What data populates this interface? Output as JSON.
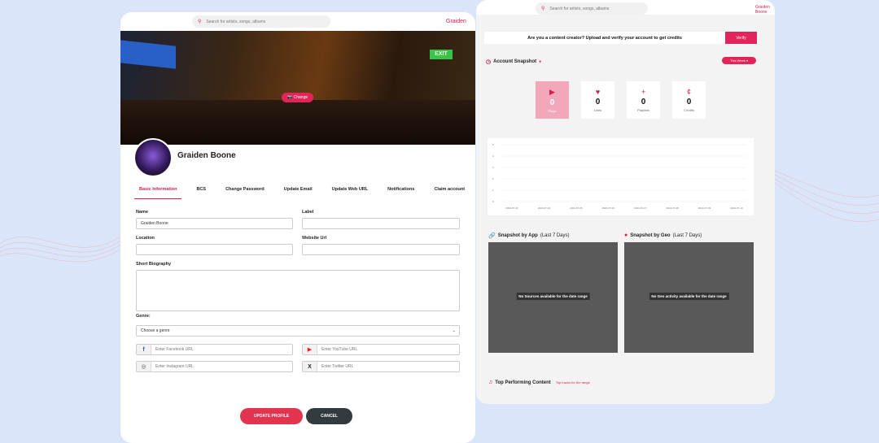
{
  "search": {
    "placeholder": "Search for artists, songs, albums",
    "icon": "search-icon"
  },
  "user_link": "Graiden Boone",
  "user_link_short": "Graiden",
  "profile": {
    "change_label": "Change",
    "name": "Graiden Boone",
    "tabs": [
      "Basic Information",
      "BCS",
      "Change Password",
      "Update Email",
      "Update Web URL",
      "Notifications",
      "Claim account"
    ],
    "active_tab": "Basic Information",
    "form": {
      "name_label": "Name",
      "name_value": "Graiden Boone",
      "label_label": "Label",
      "label_value": "",
      "location_label": "Location",
      "location_value": "",
      "website_label": "Website Url",
      "website_value": "",
      "bio_label": "Short Biography",
      "bio_value": "",
      "genre_label": "Genre:",
      "genre_value": "Choose a genre",
      "facebook_placeholder": "Enter Facebook URL",
      "youtube_placeholder": "Enter YouTube URL",
      "instagram_placeholder": "Enter Instagram URL",
      "twitter_placeholder": "Enter Twitter URL"
    },
    "update_button": "UPDATE PROFILE",
    "cancel_button": "CANCEL"
  },
  "dashboard": {
    "creator_prompt": "Are you a content creator? Upload and verify your account to get credits",
    "verify_button": "Verify",
    "snapshot_title": "Account Snapshot",
    "range_button": "This Week ▾",
    "stats": [
      {
        "icon": "play-icon",
        "glyph": "▶",
        "value": "0",
        "label": "Plays"
      },
      {
        "icon": "heart-icon",
        "glyph": "♥",
        "value": "0",
        "label": "Likes"
      },
      {
        "icon": "plus-icon",
        "glyph": "+",
        "value": "0",
        "label": "Playlists"
      },
      {
        "icon": "cent-icon",
        "glyph": "¢",
        "value": "0",
        "label": "Credits"
      }
    ],
    "app_title": "Snapshot by App",
    "app_sub": "(Last 7 Days)",
    "app_empty": "No Sources available for the date range",
    "geo_title": "Snapshot by Geo",
    "geo_sub": "(Last 7 Days)",
    "geo_empty": "No Geo activity available for the date range",
    "top_title": "Top Performing Content",
    "top_sub": "Top tracks for the range"
  },
  "chart_data": {
    "type": "line",
    "x": [
      "2024-07-03",
      "2024-07-04",
      "2024-07-05",
      "2024-07-06",
      "2024-07-07",
      "2024-07-08",
      "2024-07-09",
      "2024-07-10"
    ],
    "yticks": [
      "0",
      "1",
      "2",
      "3",
      "4",
      "5"
    ],
    "ylim": [
      0,
      5
    ],
    "series": [
      {
        "values": []
      }
    ],
    "grid": true
  },
  "colors": {
    "accent": "#e3245a",
    "background": "#dbe5fa"
  }
}
